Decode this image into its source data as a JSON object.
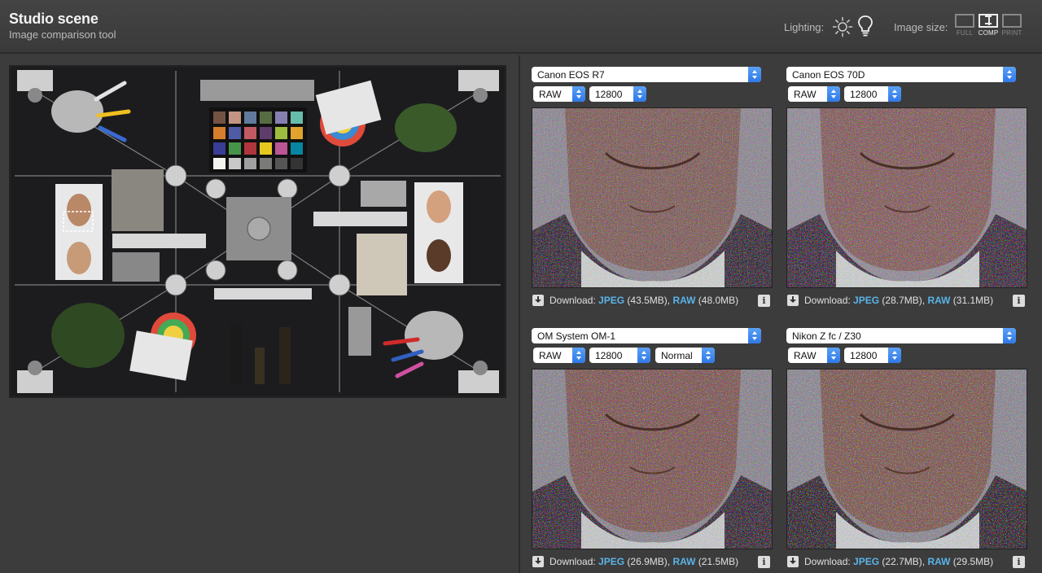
{
  "header": {
    "title": "Studio scene",
    "subtitle": "Image comparison tool",
    "lighting_label": "Lighting:",
    "image_size_label": "Image size:",
    "size_options": [
      {
        "label": "FULL",
        "active": false
      },
      {
        "label": "COMP",
        "active": true
      },
      {
        "label": "PRINT",
        "active": false
      }
    ]
  },
  "icons": {
    "sun": "sun-icon",
    "bulb": "lightbulb-icon",
    "download": "download-icon",
    "info": "info-icon"
  },
  "colors": {
    "background": "#3c3c3c",
    "link": "#5ab4e8",
    "select_accent": "#2f79e8"
  },
  "download": {
    "label": "Download:",
    "jpeg_label": "JPEG",
    "raw_label": "RAW",
    "info_glyph": "i"
  },
  "panes": [
    {
      "camera": "Canon EOS R7",
      "format": "RAW",
      "iso": "12800",
      "extra": null,
      "jpeg_size": "(43.5MB),",
      "raw_size": "(48.0MB)"
    },
    {
      "camera": "Canon EOS 70D",
      "format": "RAW",
      "iso": "12800",
      "extra": null,
      "jpeg_size": "(28.7MB),",
      "raw_size": "(31.1MB)"
    },
    {
      "camera": "OM System OM-1",
      "format": "RAW",
      "iso": "12800",
      "extra": "Normal",
      "jpeg_size": "(26.9MB),",
      "raw_size": "(21.5MB)"
    },
    {
      "camera": "Nikon Z fc / Z30",
      "format": "RAW",
      "iso": "12800",
      "extra": null,
      "jpeg_size": "(22.7MB),",
      "raw_size": "(29.5MB)"
    }
  ]
}
